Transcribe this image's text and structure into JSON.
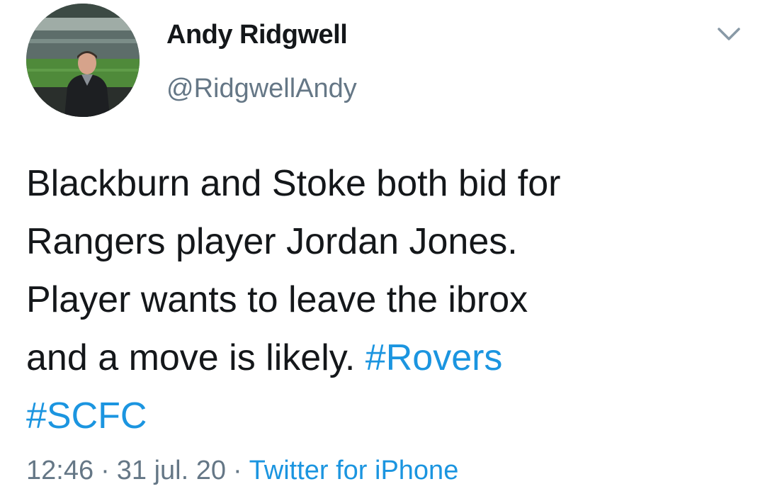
{
  "author": {
    "name": "Andy Ridgwell",
    "handle": "@RidgwellAndy"
  },
  "menu": {
    "icon": "chevron-down-icon"
  },
  "tweet": {
    "line1": "Blackburn and Stoke both bid for",
    "line2": "Rangers player Jordan Jones.",
    "line3": "Player wants to leave the ibrox",
    "line4": "and a move is likely.",
    "hashtag1": "#Rovers",
    "hashtag2": "#SCFC"
  },
  "meta": {
    "time": "12:46",
    "separator": "·",
    "date": "31 jul. 20",
    "source": "Twitter for iPhone"
  },
  "colors": {
    "text": "#14171a",
    "secondary": "#657786",
    "link": "#1b95e0",
    "chevron": "#8899a6"
  }
}
